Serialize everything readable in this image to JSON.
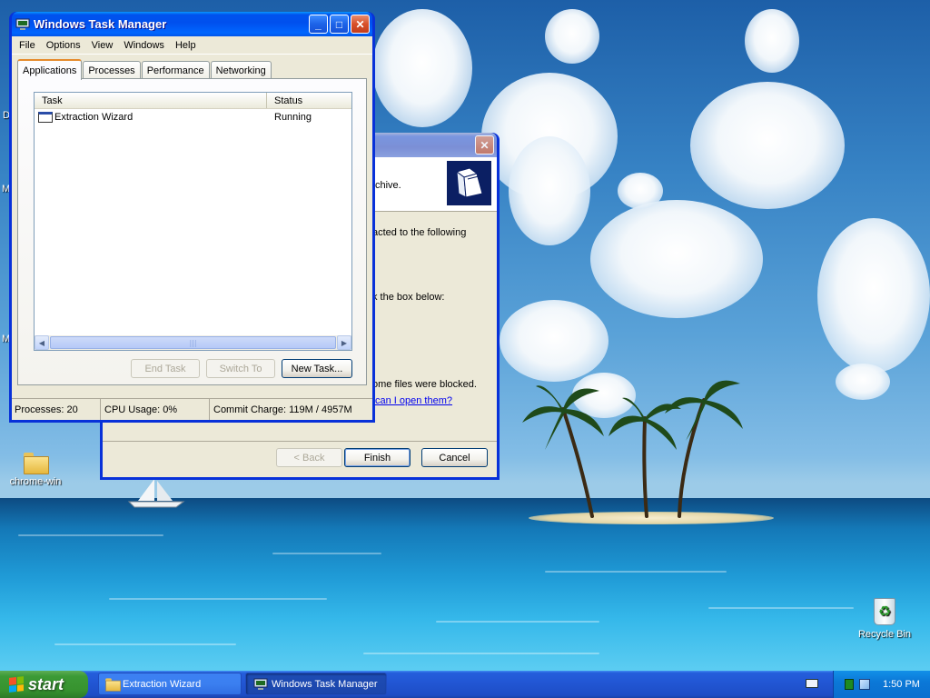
{
  "desktop": {
    "icons": [
      {
        "label": "chrome-win",
        "icon": "folder-icon"
      },
      {
        "label": "Recycle Bin",
        "icon": "recycle-bin-icon"
      }
    ],
    "edge_letters": [
      "D",
      "M",
      "M"
    ]
  },
  "wizard": {
    "title": "Extraction Wizard",
    "header_text": "chive.",
    "line1": "acted to the following",
    "line2": "k the box below:",
    "line3": "ome files were blocked.",
    "link": "can I open them?",
    "buttons": {
      "back": "< Back",
      "finish": "Finish",
      "cancel": "Cancel"
    }
  },
  "taskmgr": {
    "title": "Windows Task Manager",
    "window_controls": {
      "minimize": "_",
      "maximize": "□",
      "close": "✕"
    },
    "menu": [
      "File",
      "Options",
      "View",
      "Windows",
      "Help"
    ],
    "tabs": [
      "Applications",
      "Processes",
      "Performance",
      "Networking"
    ],
    "active_tab": "Applications",
    "columns": [
      "Task",
      "Status"
    ],
    "rows": [
      {
        "task": "Extraction Wizard",
        "status": "Running"
      }
    ],
    "buttons": {
      "end_task": "End Task",
      "switch_to": "Switch To",
      "new_task": "New Task..."
    },
    "status": {
      "processes": "Processes: 20",
      "cpu": "CPU Usage: 0%",
      "commit": "Commit Charge: 119M / 4957M"
    }
  },
  "taskbar": {
    "start_label": "start",
    "tasks": [
      {
        "label": "Extraction Wizard",
        "icon": "folder-icon",
        "active": false
      },
      {
        "label": "Windows Task Manager",
        "icon": "task-manager-icon",
        "active": true
      }
    ],
    "clock": "1:50 PM"
  },
  "colors": {
    "xp_blue": "#0831d9",
    "start_green": "#37932f",
    "tray_blue": "#0b78d7",
    "tab_highlight": "#e68b2c"
  }
}
